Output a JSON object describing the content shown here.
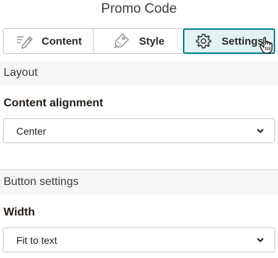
{
  "panel": {
    "title": "Promo Code"
  },
  "tabs": [
    {
      "label": "Content",
      "icon": "edit-pencil-icon",
      "active": false
    },
    {
      "label": "Style",
      "icon": "paint-tag-icon",
      "active": false
    },
    {
      "label": "Settings",
      "icon": "gear-icon",
      "active": true
    }
  ],
  "sections": {
    "layout": {
      "heading": "Layout",
      "field_label": "Content alignment",
      "selected": "Center"
    },
    "button": {
      "heading": "Button settings",
      "field_label": "Width",
      "selected": "Fit to text"
    }
  },
  "colors": {
    "accent": "#007c89",
    "active_tab_bg": "#e3f2f3",
    "section_bg": "#f6f6f4"
  }
}
